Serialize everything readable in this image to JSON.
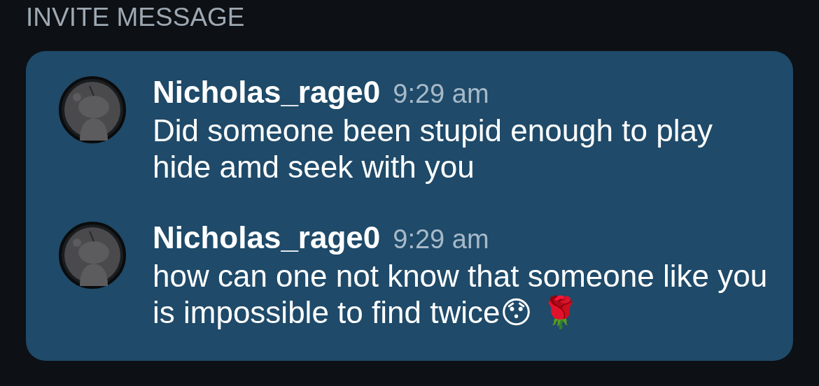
{
  "header": {
    "title": "INVITE MESSAGE"
  },
  "messages": [
    {
      "author": "Nicholas_rage0",
      "time": "9:29 am",
      "text": "Did someone been stupid enough to play hide amd seek with you"
    },
    {
      "author": "Nicholas_rage0",
      "time": "9:29 am",
      "text": "how can one not know that someone like you is impossible to find twice😯 🌹"
    }
  ]
}
